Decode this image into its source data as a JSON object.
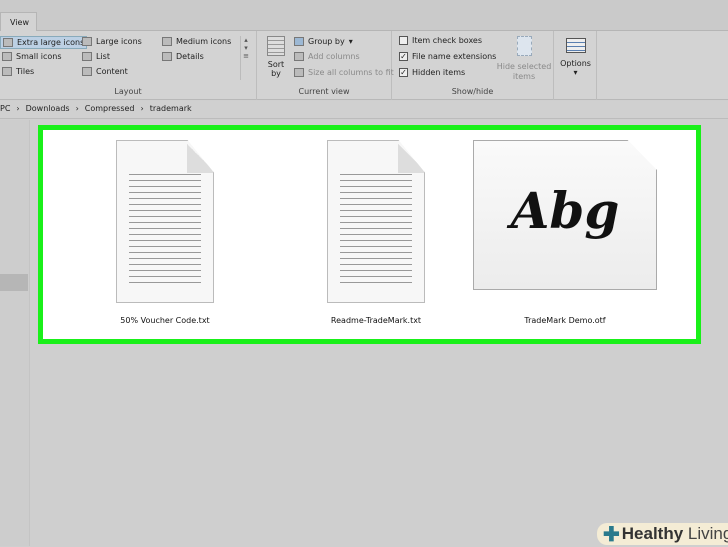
{
  "tabs": {
    "view": "View"
  },
  "layout": {
    "label": "Layout",
    "items": [
      "Extra large icons",
      "Large icons",
      "Medium icons",
      "Small icons",
      "List",
      "Details",
      "Tiles",
      "Content"
    ]
  },
  "current_view": {
    "label": "Current view",
    "sort_by": "Sort by",
    "group_by": "Group by",
    "add_columns": "Add columns",
    "size_columns": "Size all columns to fit"
  },
  "show_hide": {
    "label": "Show/hide",
    "item_check_boxes": {
      "label": "Item check boxes",
      "checked": false
    },
    "file_name_extensions": {
      "label": "File name extensions",
      "checked": true
    },
    "hidden_items": {
      "label": "Hidden items",
      "checked": true
    },
    "hide_selected": "Hide selected items",
    "options": "Options"
  },
  "breadcrumb": [
    "PC",
    "Downloads",
    "Compressed",
    "trademark"
  ],
  "files": [
    {
      "name": "50% Voucher Code.txt"
    },
    {
      "name": "Readme-TradeMark.txt"
    },
    {
      "name": "TradeMark Demo.otf",
      "preview": "Abg"
    }
  ],
  "watermark": {
    "text_bold": "Healthy",
    "text": "Living"
  },
  "colors": {
    "highlight": "#19f019"
  }
}
